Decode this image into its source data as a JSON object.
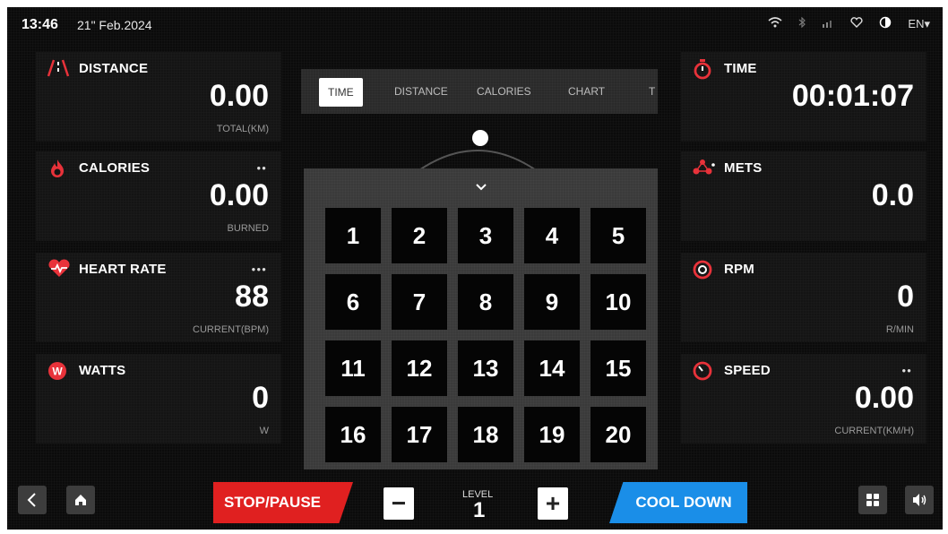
{
  "status_bar": {
    "time": "13:46",
    "date": "21\" Feb.2024",
    "language": "EN▾",
    "icons": [
      "wifi-icon",
      "bluetooth-icon",
      "signal-icon",
      "heart-outline-icon",
      "contrast-icon"
    ]
  },
  "left_panels": [
    {
      "label": "DISTANCE",
      "value": "0.00",
      "unit": "TOTAL(KM)",
      "dots": "",
      "icon": "distance-road-icon"
    },
    {
      "label": "CALORIES",
      "value": "0.00",
      "unit": "BURNED",
      "dots": "●●",
      "icon": "flame-icon"
    },
    {
      "label": "HEART RATE",
      "value": "88",
      "unit": "CURRENT(BPM)",
      "dots": "●●●",
      "icon": "heart-pulse-icon"
    },
    {
      "label": "WATTS",
      "value": "0",
      "unit": "W",
      "dots": "",
      "icon": "watts-icon"
    }
  ],
  "right_panels": [
    {
      "label": "TIME",
      "value": "00:01:07",
      "unit": "",
      "dots": "",
      "icon": "stopwatch-icon"
    },
    {
      "label": "METS",
      "value": "0.0",
      "unit": "",
      "dots": "",
      "icon": "mets-icon"
    },
    {
      "label": "RPM",
      "value": "0",
      "unit": "R/MIN",
      "dots": "",
      "icon": "rpm-icon"
    },
    {
      "label": "SPEED",
      "value": "0.00",
      "unit": "CURRENT(KM/H)",
      "dots": "●●",
      "icon": "speed-icon"
    }
  ],
  "tabs": [
    {
      "label": "TIME",
      "active": true
    },
    {
      "label": "DISTANCE",
      "active": false
    },
    {
      "label": "CALORIES",
      "active": false
    },
    {
      "label": "CHART",
      "active": false
    },
    {
      "label": "T",
      "active": false
    }
  ],
  "keypad": {
    "keys": [
      "1",
      "2",
      "3",
      "4",
      "5",
      "6",
      "7",
      "8",
      "9",
      "10",
      "11",
      "12",
      "13",
      "14",
      "15",
      "16",
      "17",
      "18",
      "19",
      "20"
    ]
  },
  "bottom_bar": {
    "stop_label": "STOP/PAUSE",
    "cool_down_label": "COOL DOWN",
    "level_label": "LEVEL",
    "level_value": "1",
    "minus_label": "−",
    "plus_label": "+"
  },
  "colors": {
    "stop": "#e02020",
    "cool_down": "#1a8ee8",
    "icon_red": "#e8323a"
  }
}
